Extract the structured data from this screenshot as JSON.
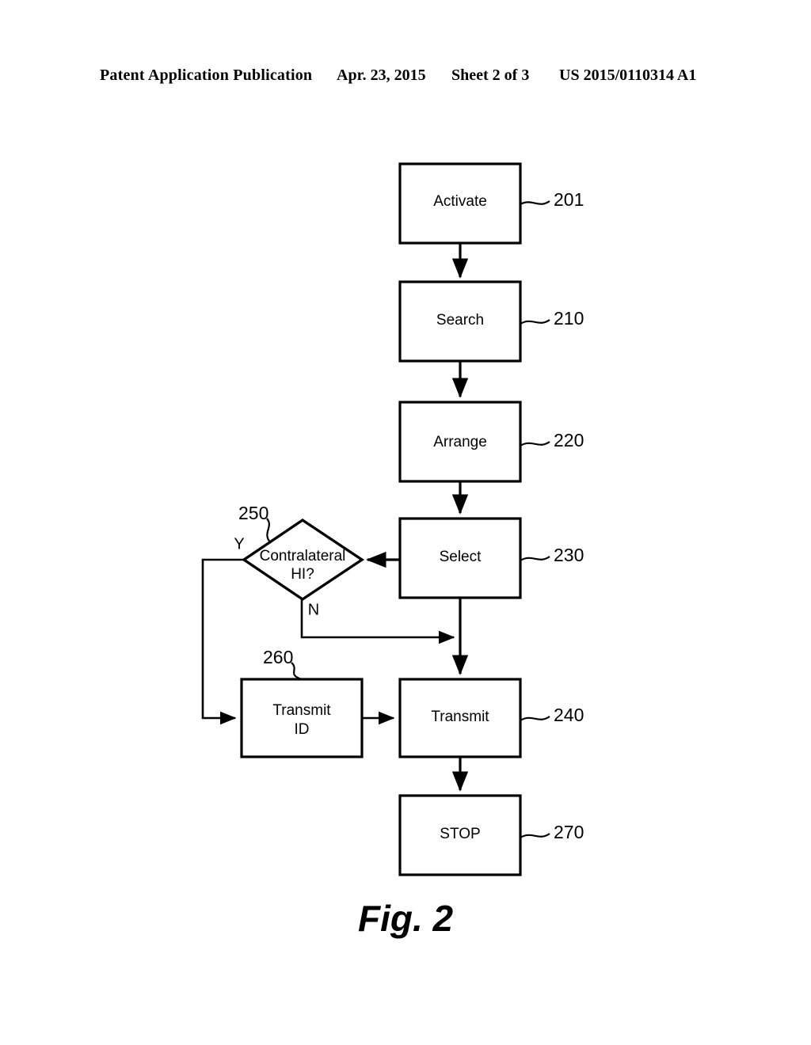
{
  "header": {
    "publication": "Patent Application Publication",
    "date": "Apr. 23, 2015",
    "sheet": "Sheet 2 of 3",
    "document_number": "US 2015/0110314 A1"
  },
  "figure": {
    "caption": "Fig. 2",
    "nodes": [
      {
        "id": "activate",
        "label": "Activate",
        "ref": "201",
        "type": "process"
      },
      {
        "id": "search",
        "label": "Search",
        "ref": "210",
        "type": "process"
      },
      {
        "id": "arrange",
        "label": "Arrange",
        "ref": "220",
        "type": "process"
      },
      {
        "id": "select",
        "label": "Select",
        "ref": "230",
        "type": "process"
      },
      {
        "id": "decision",
        "label": "Contralateral",
        "label_line2": "HI?",
        "ref": "250",
        "type": "decision"
      },
      {
        "id": "transmit-id",
        "label": "Transmit",
        "label_line2": "ID",
        "ref": "260",
        "type": "process"
      },
      {
        "id": "transmit",
        "label": "Transmit",
        "ref": "240",
        "type": "process"
      },
      {
        "id": "stop",
        "label": "STOP",
        "ref": "270",
        "type": "terminator"
      }
    ],
    "branch_labels": {
      "yes": "Y",
      "no": "N"
    }
  },
  "colors": {
    "ink": "#000000",
    "paper": "#ffffff"
  }
}
